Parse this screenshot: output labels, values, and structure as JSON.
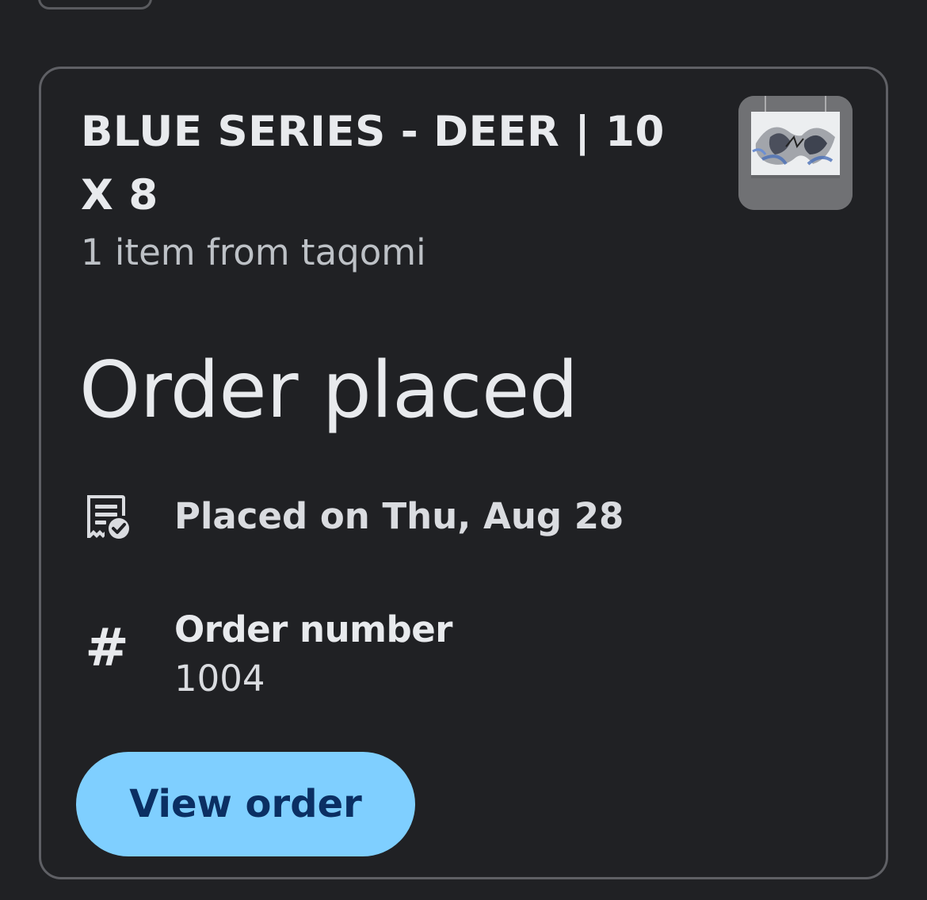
{
  "order_card": {
    "title": "BLUE SERIES - DEER | 10 X 8",
    "subtitle": "1 item from taqomi",
    "status": "Order placed",
    "placed_on": "Placed on Thu, Aug 28",
    "order_number_label": "Order number",
    "order_number_value": "1004",
    "view_order_label": "View order",
    "icons": {
      "receipt": "receipt-check-icon",
      "hash": "hash-icon"
    },
    "thumbnail": "artwork-thumbnail"
  },
  "colors": {
    "background": "#202124",
    "card_border": "#5f6065",
    "text_primary": "#e8eaed",
    "text_secondary": "#bdc1c6",
    "button_bg": "#7fcfff",
    "button_text": "#0b2f63"
  }
}
